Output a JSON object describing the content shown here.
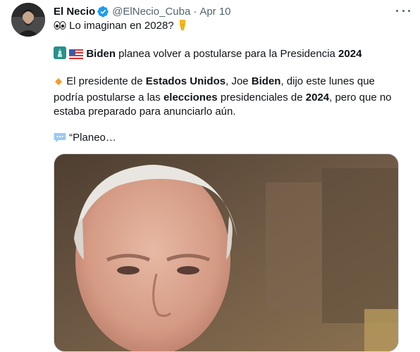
{
  "tweet": {
    "author_name": "El Necio",
    "handle": "@ElNecio_Cuba",
    "separator": "·",
    "date": "Apr 10",
    "intro": "Lo imaginan en 2028?",
    "headline": {
      "bold_name": "Biden",
      "rest": " planea volver a postularse para la Presidencia ",
      "year": "2024"
    },
    "body": {
      "p1": "El presidente de ",
      "b1": "Estados Unidos",
      "p2": ", Joe ",
      "b2": "Biden",
      "p3": ", dijo este lunes que podría postularse a las ",
      "b3": "elecciones",
      "p4": " presidenciales de ",
      "b4": "2024",
      "p5": ", pero que no estaba preparado para anunciarlo aún."
    },
    "quote": "“Planeo…"
  },
  "icons": {
    "verified": "verified-badge-icon",
    "more": "more-options-icon",
    "eyes": "eyes-emoji",
    "point_down": "point-down-emoji",
    "statue_liberty": "statue-of-liberty-emoji",
    "us_flag": "us-flag-emoji",
    "orange_diamond": "orange-diamond-emoji",
    "speech_bubble": "speech-bubble-emoji"
  },
  "colors": {
    "text": "#0f1419",
    "secondary": "#536471",
    "verified": "#1d9bf0"
  }
}
